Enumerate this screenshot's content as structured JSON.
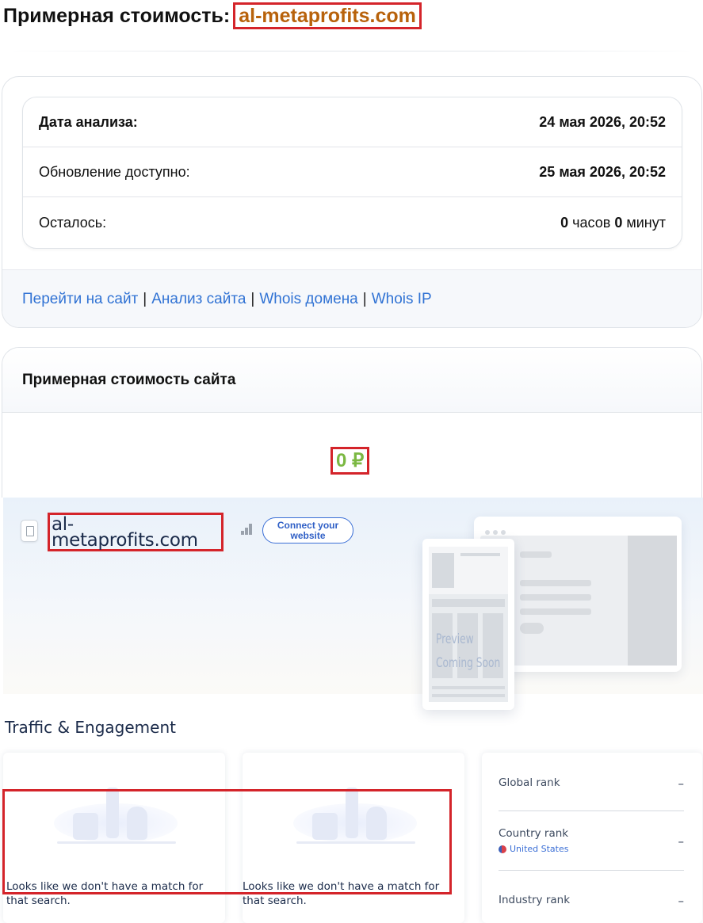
{
  "header": {
    "title_prefix": "Примерная стоимость:",
    "domain": "al-metaprofits.com"
  },
  "info": {
    "rows": [
      {
        "label": "Дата анализа:",
        "value": "24 мая 2026, 20:52"
      },
      {
        "label": "Обновление доступно:",
        "value": "25 мая 2026, 20:52"
      }
    ],
    "remaining": {
      "label": "Осталось:",
      "hours": "0",
      "hours_unit": "часов",
      "minutes": "0",
      "minutes_unit": "минут"
    },
    "links": {
      "goto_site": "Перейти на сайт",
      "site_analysis": "Анализ сайта",
      "whois_domain": "Whois домена",
      "whois_ip": "Whois IP",
      "separator": "|"
    }
  },
  "estimate": {
    "heading": "Примерная стоимость сайта",
    "price": "0 ₽",
    "price_color": "#7bb842"
  },
  "similarweb": {
    "domain_line1": "al-",
    "domain_line2": "metaprofits.com",
    "connect_label_line1": "Connect your",
    "connect_label_line2": "website",
    "preview_line1": "Preview",
    "preview_line2": "Coming Soon",
    "section_heading": "Traffic & Engagement",
    "no_match_text": "Looks like we don't have a match for that search.",
    "ranks": {
      "global_label": "Global rank",
      "global_value": "–",
      "country_label": "Country rank",
      "country_value": "–",
      "country_name": "United States",
      "industry_label": "Industry rank",
      "industry_value": "–"
    }
  },
  "colors": {
    "domain_orange": "#b8620b",
    "link_blue": "#3173d4",
    "highlight_red": "#d4242a",
    "navy_text": "#1b2b4a"
  }
}
